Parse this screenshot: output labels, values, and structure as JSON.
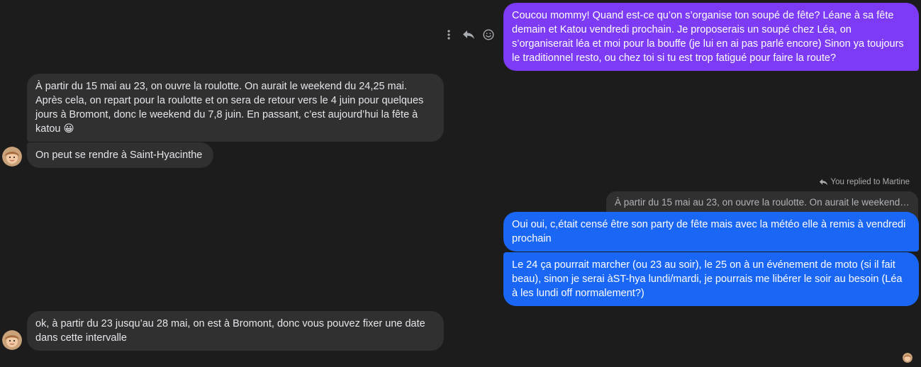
{
  "conversation": {
    "messages": [
      {
        "direction": "outgoing",
        "text": "Coucou mommy! Quand est-ce qu’on s’organise ton soupé de fête? Léane à sa fête demain et Katou vendredi prochain. Je proposerais un soupé chez Léa, on s’organiserait léa et moi pour la bouffe (je lui en ai pas parlé encore) Sinon ya toujours le traditionnel resto, ou chez toi si tu est trop fatigué pour faire la route?"
      },
      {
        "direction": "incoming",
        "text": "À partir du 15 mai au 23, on ouvre la roulotte. On aurait le weekend du 24,25 mai. Après cela, on repart pour la roulotte et on sera de retour vers le 4 juin pour quelques jours à Bromont, donc le weekend du 7,8 juin. En passant, c’est aujourd’hui la fête à katou",
        "emoji": "😀"
      },
      {
        "direction": "incoming",
        "text": "On peut se rendre à Saint-Hyacinthe"
      },
      {
        "direction": "outgoing",
        "reply_label": "You replied to Martine",
        "quoted_text": "À partir du 15 mai au 23, on ouvre la roulotte. On aurait le weekend du ...",
        "text": "Oui oui, c,était censé être son party de fête mais avec la météo elle à remis à vendredi prochain"
      },
      {
        "direction": "outgoing",
        "text": "Le 24 ça pourrait marcher (ou 23 au soir), le 25 on à un événement de moto (si il fait beau), sinon je serai àST-hya lundi/mardi, je pourrais me libérer le soir au besoin (Léa à les lundi off normalement?)"
      },
      {
        "direction": "incoming",
        "text": "ok, à partir du 23 jusqu’au 28 mai, on est à Bromont, donc vous pouvez fixer une date dans cette intervalle"
      }
    ]
  },
  "hover_actions": [
    "more-options-icon",
    "reply-icon",
    "react-emoji-icon"
  ],
  "colors": {
    "background": "#1c1c1c",
    "incoming_bubble": "#303030",
    "outgoing_purple": "#7d3bf5",
    "outgoing_blue": "#1b67f5"
  }
}
